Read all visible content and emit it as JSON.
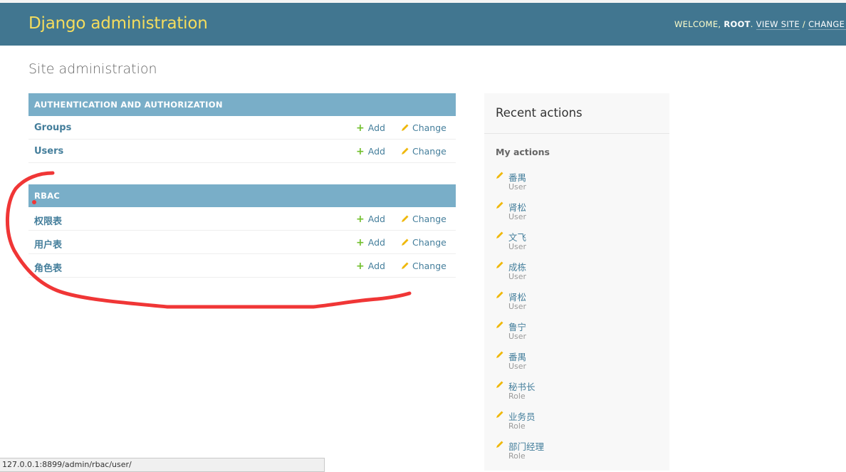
{
  "header": {
    "title": "Django administration",
    "welcome": "WELCOME,",
    "username": "ROOT",
    "view_site": "VIEW SITE",
    "separator": "/",
    "change_password": "CHANGE PA"
  },
  "page_title": "Site administration",
  "modules": [
    {
      "caption": "AUTHENTICATION AND AUTHORIZATION",
      "rows": [
        {
          "name": "Groups",
          "add": "Add",
          "change": "Change"
        },
        {
          "name": "Users",
          "add": "Add",
          "change": "Change"
        }
      ]
    },
    {
      "caption": "RBAC",
      "rows": [
        {
          "name": "权限表",
          "add": "Add",
          "change": "Change"
        },
        {
          "name": "用户表",
          "add": "Add",
          "change": "Change"
        },
        {
          "name": "角色表",
          "add": "Add",
          "change": "Change"
        }
      ]
    }
  ],
  "recent": {
    "title": "Recent actions",
    "subtitle": "My actions",
    "items": [
      {
        "name": "番禺",
        "type": "User"
      },
      {
        "name": "肾松",
        "type": "User"
      },
      {
        "name": "文飞",
        "type": "User"
      },
      {
        "name": "成栋",
        "type": "User"
      },
      {
        "name": "肾松",
        "type": "User"
      },
      {
        "name": "鲁宁",
        "type": "User"
      },
      {
        "name": "番禺",
        "type": "User"
      },
      {
        "name": "秘书长",
        "type": "Role"
      },
      {
        "name": "业务员",
        "type": "Role"
      },
      {
        "name": "部门经理",
        "type": "Role"
      }
    ]
  },
  "statusbar": {
    "url": "127.0.0.1:8899/admin/rbac/user/"
  },
  "colors": {
    "header_bg": "#417690",
    "branding": "#f5dd5d",
    "caption_bg": "#79aec8",
    "link": "#447e9b",
    "add_icon": "#70bf2b",
    "change_icon": "#efb80b",
    "annotation": "#f03636"
  },
  "icons": {
    "add": "plus-icon",
    "change": "pencil-icon"
  }
}
